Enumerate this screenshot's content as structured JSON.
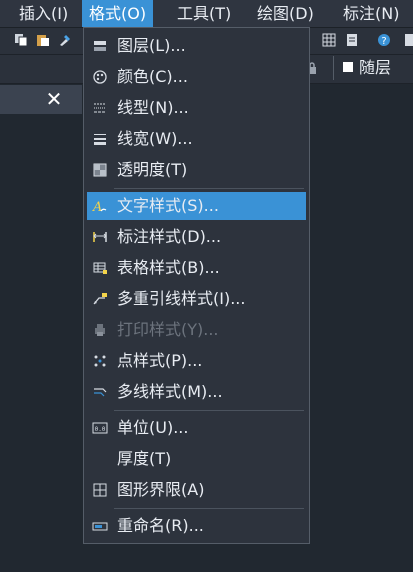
{
  "menubar": {
    "items": [
      {
        "label": "插入(I)",
        "active": false
      },
      {
        "label": "格式(O)",
        "active": true
      },
      {
        "label": "工具(T)",
        "active": false
      },
      {
        "label": "绘图(D)",
        "active": false
      },
      {
        "label": "标注(N)",
        "active": false
      }
    ]
  },
  "layer_combo": {
    "value": "随层"
  },
  "format_menu": {
    "items": [
      {
        "label": "图层(L)...",
        "icon": "layers-icon"
      },
      {
        "label": "颜色(C)...",
        "icon": "palette-icon"
      },
      {
        "label": "线型(N)...",
        "icon": "linetype-icon"
      },
      {
        "label": "线宽(W)...",
        "icon": "lineweight-icon"
      },
      {
        "label": "透明度(T)",
        "icon": "transparency-icon"
      },
      {
        "label": "文字样式(S)...",
        "icon": "text-style-icon",
        "highlighted": true
      },
      {
        "label": "标注样式(D)...",
        "icon": "dimension-style-icon"
      },
      {
        "label": "表格样式(B)...",
        "icon": "table-style-icon"
      },
      {
        "label": "多重引线样式(I)...",
        "icon": "multileader-style-icon"
      },
      {
        "label": "打印样式(Y)...",
        "icon": "print-style-icon",
        "disabled": true
      },
      {
        "label": "点样式(P)...",
        "icon": "point-style-icon"
      },
      {
        "label": "多线样式(M)...",
        "icon": "multiline-style-icon"
      },
      {
        "label": "单位(U)...",
        "icon": "units-icon"
      },
      {
        "label": "厚度(T)",
        "icon": "none"
      },
      {
        "label": "图形界限(A)",
        "icon": "drawing-limits-icon"
      },
      {
        "label": "重命名(R)...",
        "icon": "rename-icon"
      }
    ]
  },
  "colors": {
    "accent": "#3a92d6",
    "menu_bg": "#2d333d",
    "disabled_text": "#6c737d"
  }
}
